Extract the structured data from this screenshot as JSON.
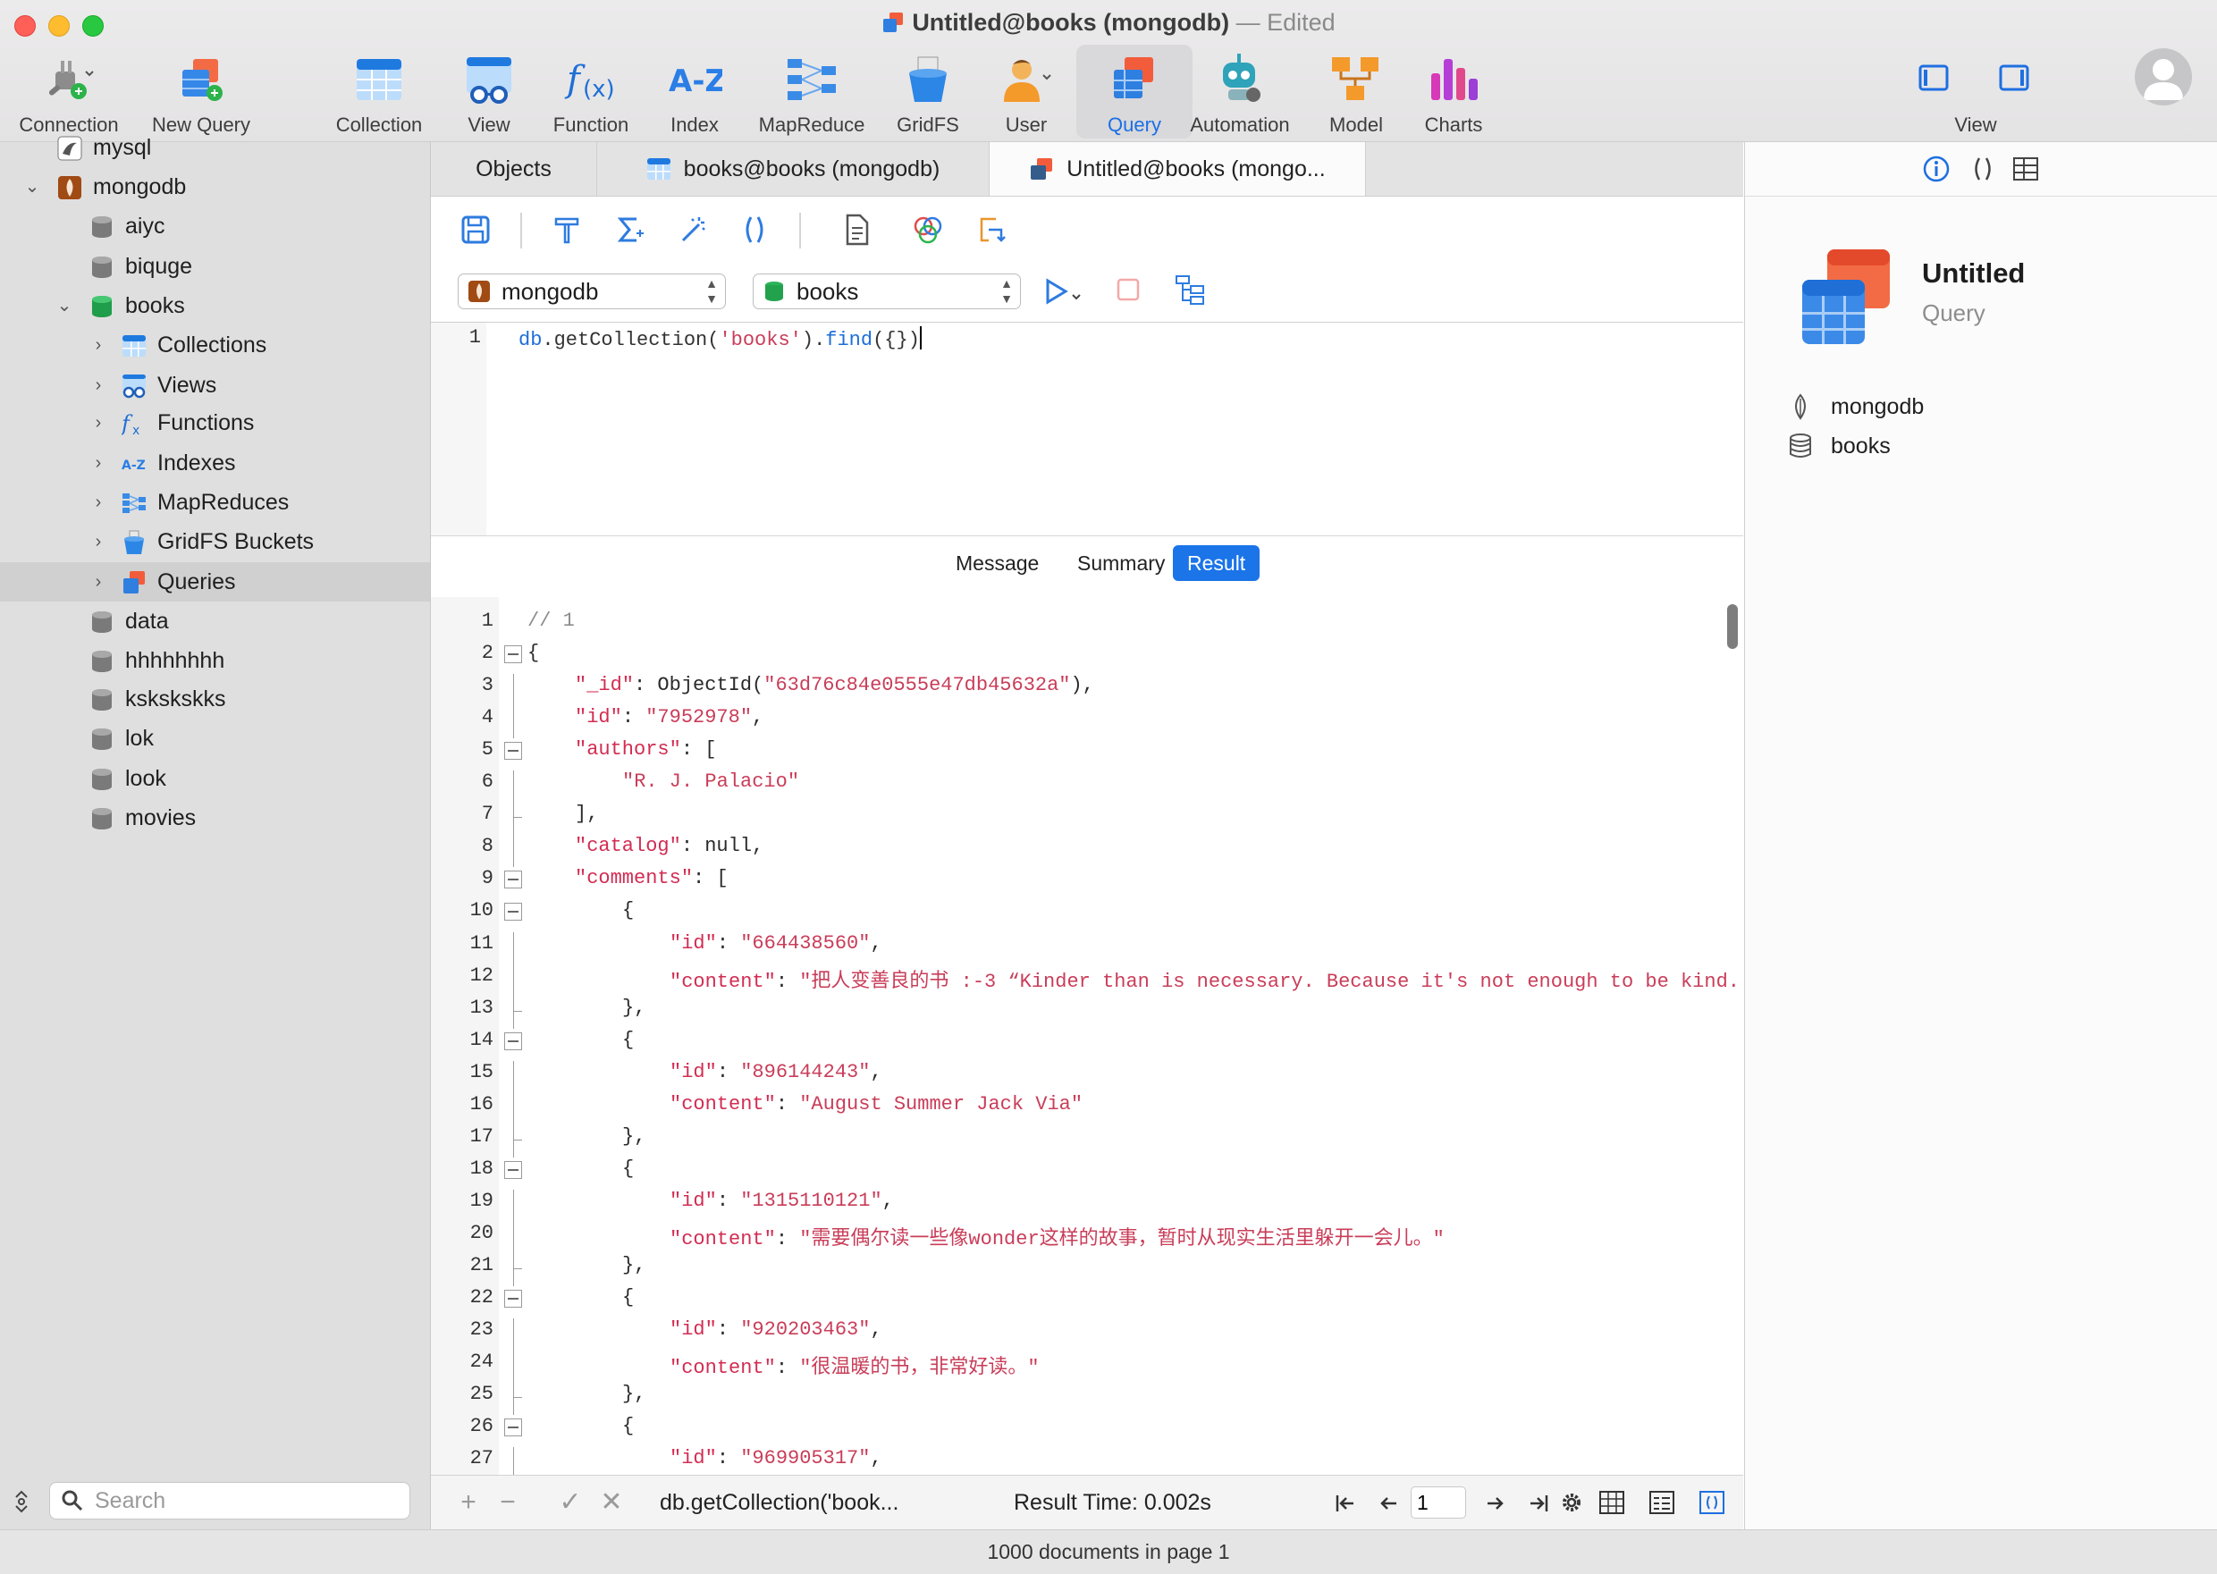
{
  "window": {
    "title": "Untitled@books (mongodb)",
    "edited": "— Edited"
  },
  "toolbar": {
    "items": [
      {
        "label": "Connection",
        "icon": "connection-plug-icon"
      },
      {
        "label": "New Query",
        "icon": "new-query-icon"
      },
      {
        "label": "Collection",
        "icon": "collection-table-icon"
      },
      {
        "label": "View",
        "icon": "view-glasses-icon"
      },
      {
        "label": "Function",
        "icon": "function-fx-icon"
      },
      {
        "label": "Index",
        "icon": "index-az-icon"
      },
      {
        "label": "MapReduce",
        "icon": "mapreduce-icon"
      },
      {
        "label": "GridFS",
        "icon": "gridfs-bucket-icon"
      },
      {
        "label": "User",
        "icon": "user-icon"
      },
      {
        "label": "Query",
        "icon": "query-icon"
      },
      {
        "label": "Automation",
        "icon": "automation-robot-icon"
      },
      {
        "label": "Model",
        "icon": "model-icon"
      },
      {
        "label": "Charts",
        "icon": "charts-icon"
      }
    ],
    "active": "Query",
    "view_label": "View"
  },
  "sidebar": {
    "tree": [
      {
        "label": "mysql"
      },
      {
        "label": "mongodb"
      },
      {
        "label": "aiyc"
      },
      {
        "label": "biquge"
      },
      {
        "label": "books"
      },
      {
        "label": "Collections"
      },
      {
        "label": "Views"
      },
      {
        "label": "Functions"
      },
      {
        "label": "Indexes"
      },
      {
        "label": "MapReduces"
      },
      {
        "label": "GridFS Buckets"
      },
      {
        "label": "Queries"
      },
      {
        "label": "data"
      },
      {
        "label": "hhhhhhhh"
      },
      {
        "label": "kskskskks"
      },
      {
        "label": "lok"
      },
      {
        "label": "look"
      },
      {
        "label": "movies"
      }
    ],
    "search_placeholder": "Search"
  },
  "tabs": [
    {
      "label": "Objects"
    },
    {
      "label": "books@books (mongodb)"
    },
    {
      "label": "Untitled@books (mongo..."
    }
  ],
  "query": {
    "connection": "mongodb",
    "database": "books",
    "line_number": "1",
    "code_db": "db",
    "code_mid": ".getCollection(",
    "code_str": "'books'",
    "code_close": ").",
    "code_find": "find",
    "code_end": "({})"
  },
  "result_tabs": [
    "Message",
    "Summary",
    "Result"
  ],
  "result_active": "Result",
  "result_lines": [
    {
      "n": "1",
      "t": "// 1"
    },
    {
      "n": "2",
      "t": "{"
    },
    {
      "n": "3",
      "k": "\"_id\"",
      "r": ": ObjectId(",
      "s": "\"63d76c84e0555e47db45632a\"",
      "e": "),"
    },
    {
      "n": "4",
      "k": "\"id\"",
      "r": ": ",
      "s": "\"7952978\"",
      "e": ","
    },
    {
      "n": "5",
      "k": "\"authors\"",
      "r": ": [",
      "s": "",
      "e": ""
    },
    {
      "n": "6",
      "k": "",
      "r": "",
      "s": "\"R. J. Palacio\"",
      "e": ""
    },
    {
      "n": "7",
      "t": "],"
    },
    {
      "n": "8",
      "k": "\"catalog\"",
      "r": ": null,",
      "s": "",
      "e": ""
    },
    {
      "n": "9",
      "k": "\"comments\"",
      "r": ": [",
      "s": "",
      "e": ""
    },
    {
      "n": "10",
      "t": "{"
    },
    {
      "n": "11",
      "k": "\"id\"",
      "r": ": ",
      "s": "\"664438560\"",
      "e": ","
    },
    {
      "n": "12",
      "k": "\"content\"",
      "r": ": ",
      "s": "\"把人变善良的书 :-3 “Kinder than is necessary. Because it's not enough to be kind.",
      "e": ""
    },
    {
      "n": "13",
      "t": "},"
    },
    {
      "n": "14",
      "t": "{"
    },
    {
      "n": "15",
      "k": "\"id\"",
      "r": ": ",
      "s": "\"896144243\"",
      "e": ","
    },
    {
      "n": "16",
      "k": "\"content\"",
      "r": ": ",
      "s": "\"August Summer Jack Via\"",
      "e": ""
    },
    {
      "n": "17",
      "t": "},"
    },
    {
      "n": "18",
      "t": "{"
    },
    {
      "n": "19",
      "k": "\"id\"",
      "r": ": ",
      "s": "\"1315110121\"",
      "e": ","
    },
    {
      "n": "20",
      "k": "\"content\"",
      "r": ": ",
      "s": "\"需要偶尔读一些像wonder这样的故事，暂时从现实生活里躲开一会儿。\"",
      "e": ""
    },
    {
      "n": "21",
      "t": "},"
    },
    {
      "n": "22",
      "t": "{"
    },
    {
      "n": "23",
      "k": "\"id\"",
      "r": ": ",
      "s": "\"920203463\"",
      "e": ","
    },
    {
      "n": "24",
      "k": "\"content\"",
      "r": ": ",
      "s": "\"很温暖的书，非常好读。\"",
      "e": ""
    },
    {
      "n": "25",
      "t": "},"
    },
    {
      "n": "26",
      "t": "{"
    },
    {
      "n": "27",
      "k": "\"id\"",
      "r": ": ",
      "s": "\"969905317\"",
      "e": ","
    }
  ],
  "status": {
    "query_preview": "db.getCollection('book...",
    "result_time": "Result Time: 0.002s",
    "page": "1",
    "documents": "1000 documents in page 1"
  },
  "inspector": {
    "name": "Untitled",
    "type": "Query",
    "connection": "mongodb",
    "database": "books"
  }
}
